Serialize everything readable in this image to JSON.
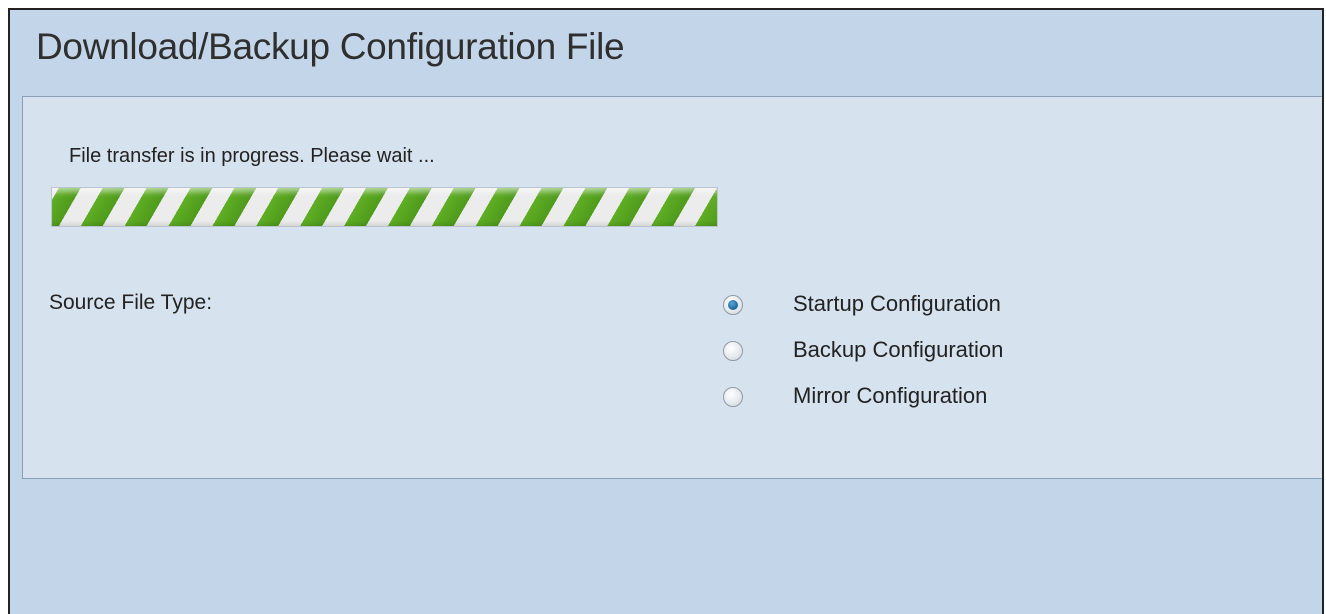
{
  "page": {
    "title": "Download/Backup Configuration File"
  },
  "transfer": {
    "status_text": "File transfer is in progress. Please wait ...",
    "progress_style": "indeterminate-striped",
    "colors": {
      "stripe_green": "#5fae24",
      "stripe_white": "#ececec"
    }
  },
  "source_file_type": {
    "label": "Source File Type:",
    "options": [
      {
        "label": "Startup Configuration",
        "checked": true
      },
      {
        "label": "Backup Configuration",
        "checked": false
      },
      {
        "label": "Mirror Configuration",
        "checked": false
      }
    ]
  },
  "colors": {
    "background": "#c3d5e8",
    "panel": "#d6e2ee",
    "radio_selected": "#1f6ea4"
  }
}
